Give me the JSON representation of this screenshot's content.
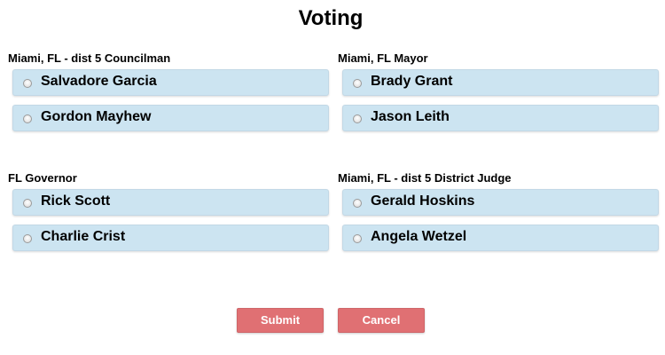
{
  "page": {
    "title": "Voting"
  },
  "groups": [
    {
      "label": "Miami, FL - dist 5 Councilman",
      "options": [
        "Salvadore Garcia",
        "Gordon Mayhew"
      ]
    },
    {
      "label": "Miami, FL Mayor",
      "options": [
        "Brady Grant",
        "Jason Leith"
      ]
    },
    {
      "label": "FL Governor",
      "options": [
        "Rick Scott",
        "Charlie Crist"
      ]
    },
    {
      "label": "Miami, FL - dist 5 District Judge",
      "options": [
        "Gerald Hoskins",
        "Angela Wetzel"
      ]
    }
  ],
  "actions": {
    "submit_label": "Submit",
    "cancel_label": "Cancel"
  },
  "colors": {
    "option_background": "#cce4f1",
    "button_background": "#e07073",
    "button_text": "#ffffff"
  }
}
